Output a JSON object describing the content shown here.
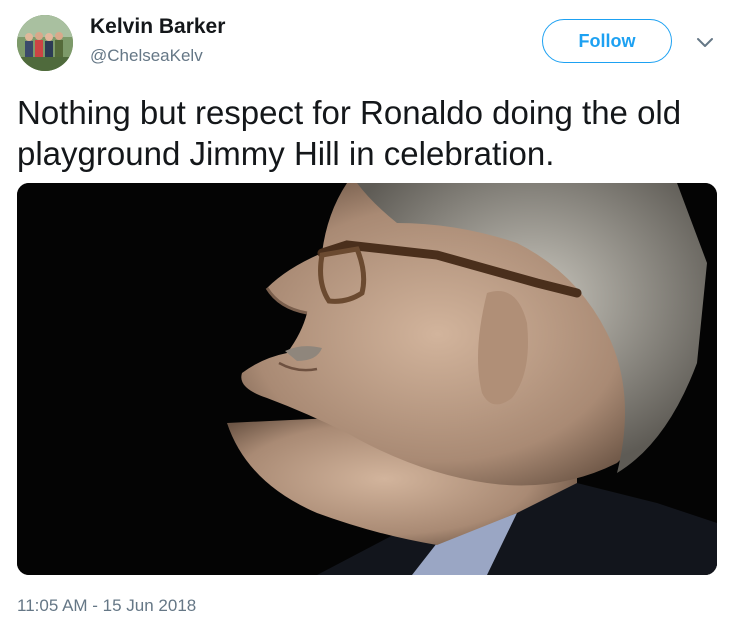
{
  "author": {
    "name": "Kelvin Barker",
    "handle": "@ChelseaKelv",
    "avatar_icon": "group-photo-avatar"
  },
  "follow_button": {
    "label": "Follow",
    "color": "#1da1f2"
  },
  "menu_icon": "chevron-down-icon",
  "tweet": {
    "text": "Nothing but respect for Ronaldo doing the old playground Jimmy Hill in celebration.",
    "timestamp": "11:05 AM - 15 Jun 2018"
  },
  "media": {
    "kind": "photo"
  }
}
